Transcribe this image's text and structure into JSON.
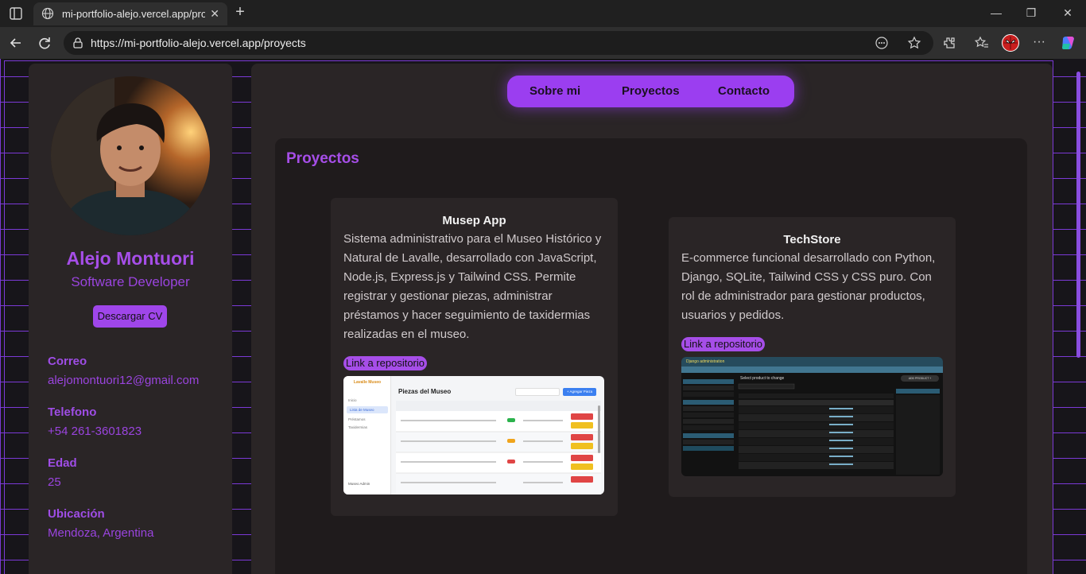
{
  "browser": {
    "tab_title": "mi-portfolio-alejo.vercel.app/proy",
    "url": "https://mi-portfolio-alejo.vercel.app/proyects"
  },
  "profile": {
    "name": "Alejo Montuori",
    "role": "Software Developer",
    "cv_button": "Descargar CV",
    "info": [
      {
        "label": "Correo",
        "value": "alejomontuori12@gmail.com"
      },
      {
        "label": "Telefono",
        "value": "+54 261-3601823"
      },
      {
        "label": "Edad",
        "value": "25"
      },
      {
        "label": "Ubicación",
        "value": "Mendoza, Argentina"
      }
    ]
  },
  "nav": {
    "items": [
      "Sobre mi",
      "Proyectos",
      "Contacto"
    ]
  },
  "projects": {
    "heading": "Proyectos",
    "items": [
      {
        "title": "Musep App",
        "description": "Sistema administrativo para el Museo Histórico y Natural de Lavalle, desarrollado con JavaScript, Node.js, Express.js y Tailwind CSS. Permite registrar y gestionar piezas, administrar préstamos y hacer seguimiento de taxidermias realizadas en el museo.",
        "link": "Link a repositorio",
        "preview": {
          "heading": "Piezas del Museo",
          "add_button": "+ Agregar Pieza",
          "logo": "Lavalle Museo",
          "menu": [
            "Inicio",
            "Lista de Museo",
            "Préstamos",
            "Taxidermias"
          ],
          "user": "Museo Admin"
        }
      },
      {
        "title": "TechStore",
        "description": "E-commerce funcional desarrollado con Python, Django, SQLite, Tailwind CSS y CSS puro. Con rol de administrador para gestionar productos, usuarios y pedidos.",
        "link": "Link a repositorio",
        "preview": {
          "header": "Django administration",
          "heading": "Select product to change",
          "add_button": "ADD PRODUCT +"
        }
      }
    ]
  }
}
